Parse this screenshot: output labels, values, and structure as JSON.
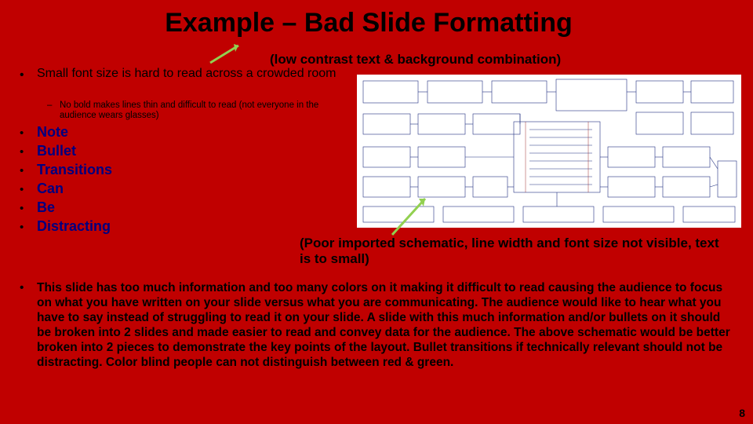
{
  "title": "Example – Bad Slide Formatting",
  "contrast_note": "(low contrast text & background combination)",
  "bullet_small_font": "Small font size is hard to read across a crowded room",
  "sub_no_bold": "No bold makes lines thin and difficult to read (not everyone in the audience wears glasses)",
  "list_items": [
    "Note",
    "Bullet",
    "Transitions",
    "Can",
    "Be",
    "Distracting"
  ],
  "schematic_note": "(Poor imported schematic, line width and font size not visible, text is to small)",
  "paragraph": "This slide has too much information and too many colors on it making it difficult to read causing the audience to focus on what you have written on your slide versus what you are communicating.  The audience would like to hear what you have to say instead of struggling to read it on your slide.  A slide with this much information and/or bullets on it should be broken into 2 slides and made easier to read and convey data for the audience.   The above schematic would be better broken into 2 pieces to demonstrate the key points of the layout.  Bullet transitions if technically relevant should not be distracting.  Color blind people can not distinguish between red & green.",
  "page_number": "8"
}
